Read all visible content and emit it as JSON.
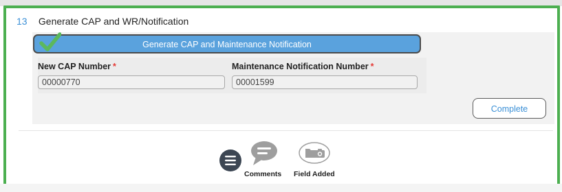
{
  "step": {
    "number": "13",
    "title": "Generate CAP and WR/Notification"
  },
  "generate_button": {
    "label": "Generate CAP and Maintenance Notification",
    "status_icon": "check-icon",
    "check_color": "#5cb85c"
  },
  "fields": {
    "cap": {
      "label": "New CAP Number",
      "required_marker": "*",
      "value": "00000770"
    },
    "maintenance_notification": {
      "label": "Maintenance Notification Number",
      "required_marker": "*",
      "value": "00001599"
    }
  },
  "complete_button": {
    "label": "Complete"
  },
  "toolbar": {
    "menu_icon": "hamburger-menu-icon",
    "comments_label": "Comments",
    "comments_icon": "speech-bubble-icon",
    "field_added_label": "Field Added",
    "field_added_icon": "folder-camera-icon"
  },
  "colors": {
    "panel_border": "#4caf50",
    "accent_blue": "#5aa2dd",
    "link_blue": "#3a8fd6",
    "required_red": "#e53935",
    "icon_gray": "#9e9e9e",
    "menu_dark": "#3c4653"
  }
}
